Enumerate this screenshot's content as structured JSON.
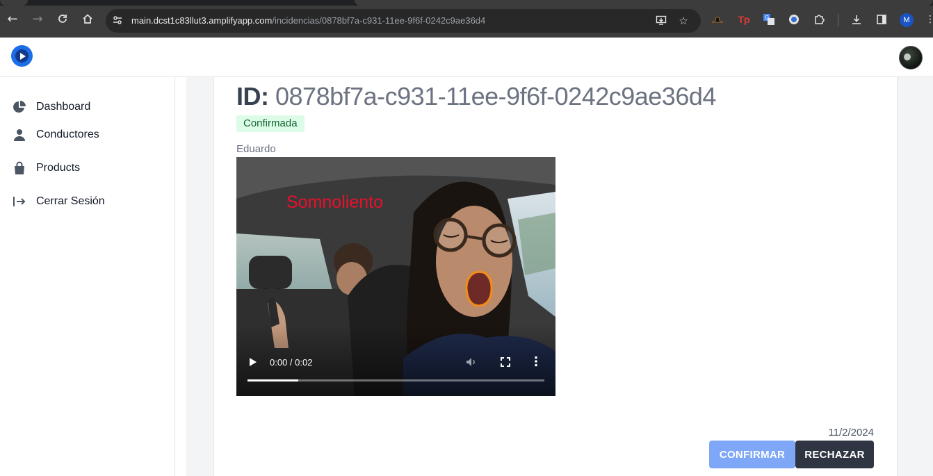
{
  "browser": {
    "url_host": "main.dcst1c83llut3.amplifyapp.com",
    "url_path": "/incidencias/0878bf7a-c931-11ee-9f6f-0242c9ae36d4",
    "profile_initial": "M",
    "extension_tp": "Tp"
  },
  "sidebar": {
    "items": [
      {
        "label": "Dashboard",
        "icon": "pie-chart-icon"
      },
      {
        "label": "Conductores",
        "icon": "user-icon"
      },
      {
        "label": "Products",
        "icon": "shopping-bag-icon"
      },
      {
        "label": "Cerrar Sesión",
        "icon": "logout-icon"
      }
    ]
  },
  "incident": {
    "id_label": "ID:",
    "id_value": "0878bf7a-c931-11ee-9f6f-0242c9ae36d4",
    "status": "Confirmada",
    "driver": "Eduardo",
    "date": "11/2/2024",
    "video": {
      "overlay_label": "Somnoliento",
      "time": "0:00 / 0:02",
      "progress": 0.17
    }
  },
  "actions": {
    "confirm_label": "CONFIRMAR",
    "reject_label": "RECHAZAR"
  },
  "colors": {
    "confirm": "#7ea8f7",
    "reject": "#2f3542",
    "badge_bg": "#dcfce7",
    "badge_text": "#166534",
    "overlay_text": "#e8102a"
  }
}
